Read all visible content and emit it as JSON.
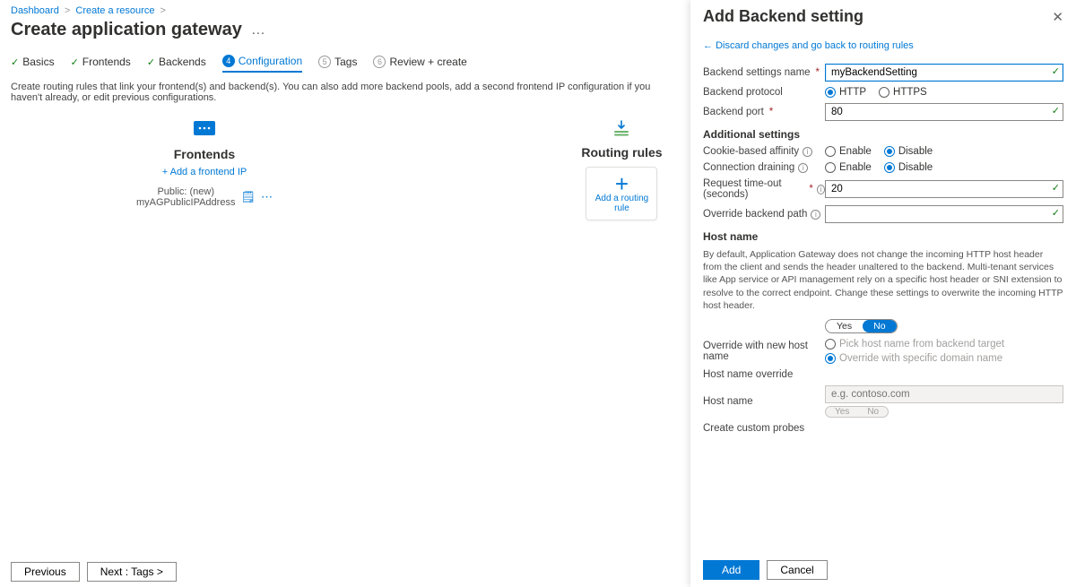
{
  "breadcrumb": [
    "Dashboard",
    "Create a resource"
  ],
  "page_title": "Create application gateway",
  "tabs": [
    {
      "label": "Basics",
      "done": true
    },
    {
      "label": "Frontends",
      "done": true
    },
    {
      "label": "Backends",
      "done": true
    },
    {
      "label": "Configuration",
      "active": true,
      "num": "4"
    },
    {
      "label": "Tags",
      "num": "5"
    },
    {
      "label": "Review + create",
      "num": "6"
    }
  ],
  "description": "Create routing rules that link your frontend(s) and backend(s). You can also add more backend pools, add a second frontend IP configuration if you haven't already, or edit previous configurations.",
  "frontends": {
    "title": "Frontends",
    "add_link": "+ Add a frontend IP",
    "item": "Public: (new) myAGPublicIPAddress"
  },
  "rules": {
    "title": "Routing rules",
    "add_label": "Add a routing rule"
  },
  "footer": {
    "prev": "Previous",
    "next": "Next : Tags >"
  },
  "panel": {
    "title": "Add Backend setting",
    "discard": "Discard changes and go back to routing rules",
    "fields": {
      "name_label": "Backend settings name",
      "name_value": "myBackendSetting",
      "protocol_label": "Backend protocol",
      "protocol_http": "HTTP",
      "protocol_https": "HTTPS",
      "port_label": "Backend port",
      "port_value": "80",
      "additional_h": "Additional settings",
      "affinity_label": "Cookie-based affinity",
      "draining_label": "Connection draining",
      "enable": "Enable",
      "disable": "Disable",
      "timeout_label": "Request time-out (seconds)",
      "timeout_value": "20",
      "override_path_label": "Override backend path",
      "hostname_h": "Host name",
      "hostname_help": "By default, Application Gateway does not change the incoming HTTP host header from the client and sends the header unaltered to the backend. Multi-tenant services like App service or API management rely on a specific host header or SNI extension to resolve to the correct endpoint. Change these settings to overwrite the incoming HTTP host header.",
      "yes": "Yes",
      "no": "No",
      "override_new_label": "Override with new host name",
      "pick_backend": "Pick host name from backend target",
      "override_specific": "Override with specific domain name",
      "hostname_override_label": "Host name override",
      "hostname_label": "Host name",
      "hostname_placeholder": "e.g. contoso.com",
      "probes_label": "Create custom probes"
    },
    "footer": {
      "add": "Add",
      "cancel": "Cancel"
    }
  }
}
